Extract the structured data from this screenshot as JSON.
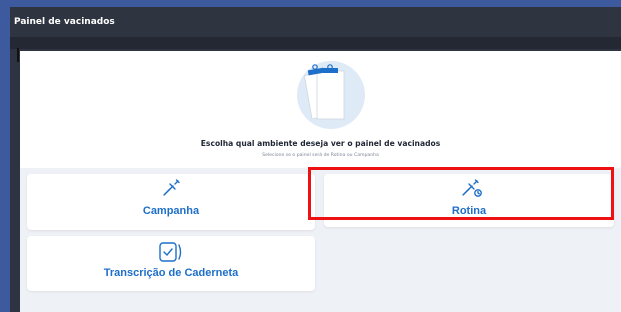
{
  "window": {
    "title": "Painel de vacinados"
  },
  "hero": {
    "title": "Escolha qual ambiente deseja ver o painel de vacinados",
    "subtitle": "Selecione se o painel será de Rotina ou Campanha",
    "illustration_icon": "clipboard-illustration"
  },
  "options": {
    "campanha": {
      "label": "Campanha",
      "icon": "syringe-icon"
    },
    "rotina": {
      "label": "Rotina",
      "icon": "syringe-clock-icon"
    },
    "transcricao": {
      "label": "Transcrição de Caderneta",
      "icon": "vaccine-card-icon"
    }
  },
  "colors": {
    "accent": "#1e6fc9",
    "titlebar": "#2e3440",
    "page_bg": "#3d5a9e",
    "highlight": "#ee1111"
  }
}
